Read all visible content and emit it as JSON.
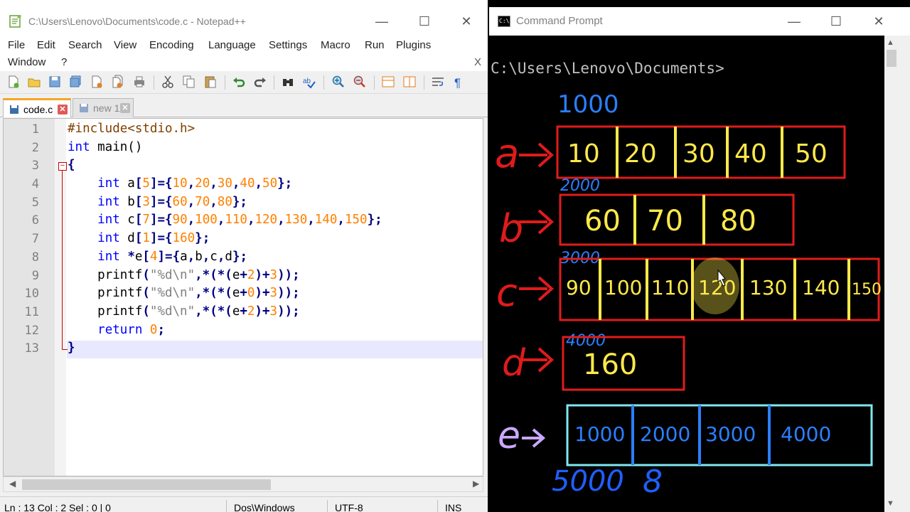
{
  "npp": {
    "title": "C:\\Users\\Lenovo\\Documents\\code.c - Notepad++",
    "menu": [
      "File",
      "Edit",
      "Search",
      "View",
      "Encoding",
      "Language",
      "Settings",
      "Macro",
      "Run",
      "Plugins",
      "Window",
      "?"
    ],
    "menu_close": "X",
    "tabs": [
      {
        "label": "code.c",
        "active": true
      },
      {
        "label": "new 1",
        "active": false
      }
    ],
    "line_numbers": [
      "1",
      "2",
      "3",
      "4",
      "5",
      "6",
      "7",
      "8",
      "9",
      "10",
      "11",
      "12",
      "13"
    ],
    "status": {
      "position": "Ln : 13    Col : 2    Sel : 0 | 0",
      "eol": "Dos\\Windows",
      "encoding": "UTF-8",
      "mode": "INS"
    }
  },
  "cmd": {
    "title": "Command Prompt",
    "prompt": "C:\\Users\\Lenovo\\Documents>",
    "annotations": {
      "a": {
        "label": "a",
        "address": "1000",
        "cells": [
          "10",
          "20",
          "30",
          "40",
          "50"
        ]
      },
      "b": {
        "label": "b",
        "address": "2000",
        "cells": [
          "60",
          "70",
          "80"
        ]
      },
      "c": {
        "label": "c",
        "address": "3000",
        "cells": [
          "90",
          "100",
          "110",
          "120",
          "130",
          "140",
          "150"
        ]
      },
      "d": {
        "label": "d",
        "address": "4000",
        "cells": [
          "160"
        ]
      },
      "e": {
        "label": "e",
        "cells": [
          "1000",
          "2000",
          "3000",
          "4000"
        ],
        "address": "5000",
        "size": "8"
      }
    }
  }
}
